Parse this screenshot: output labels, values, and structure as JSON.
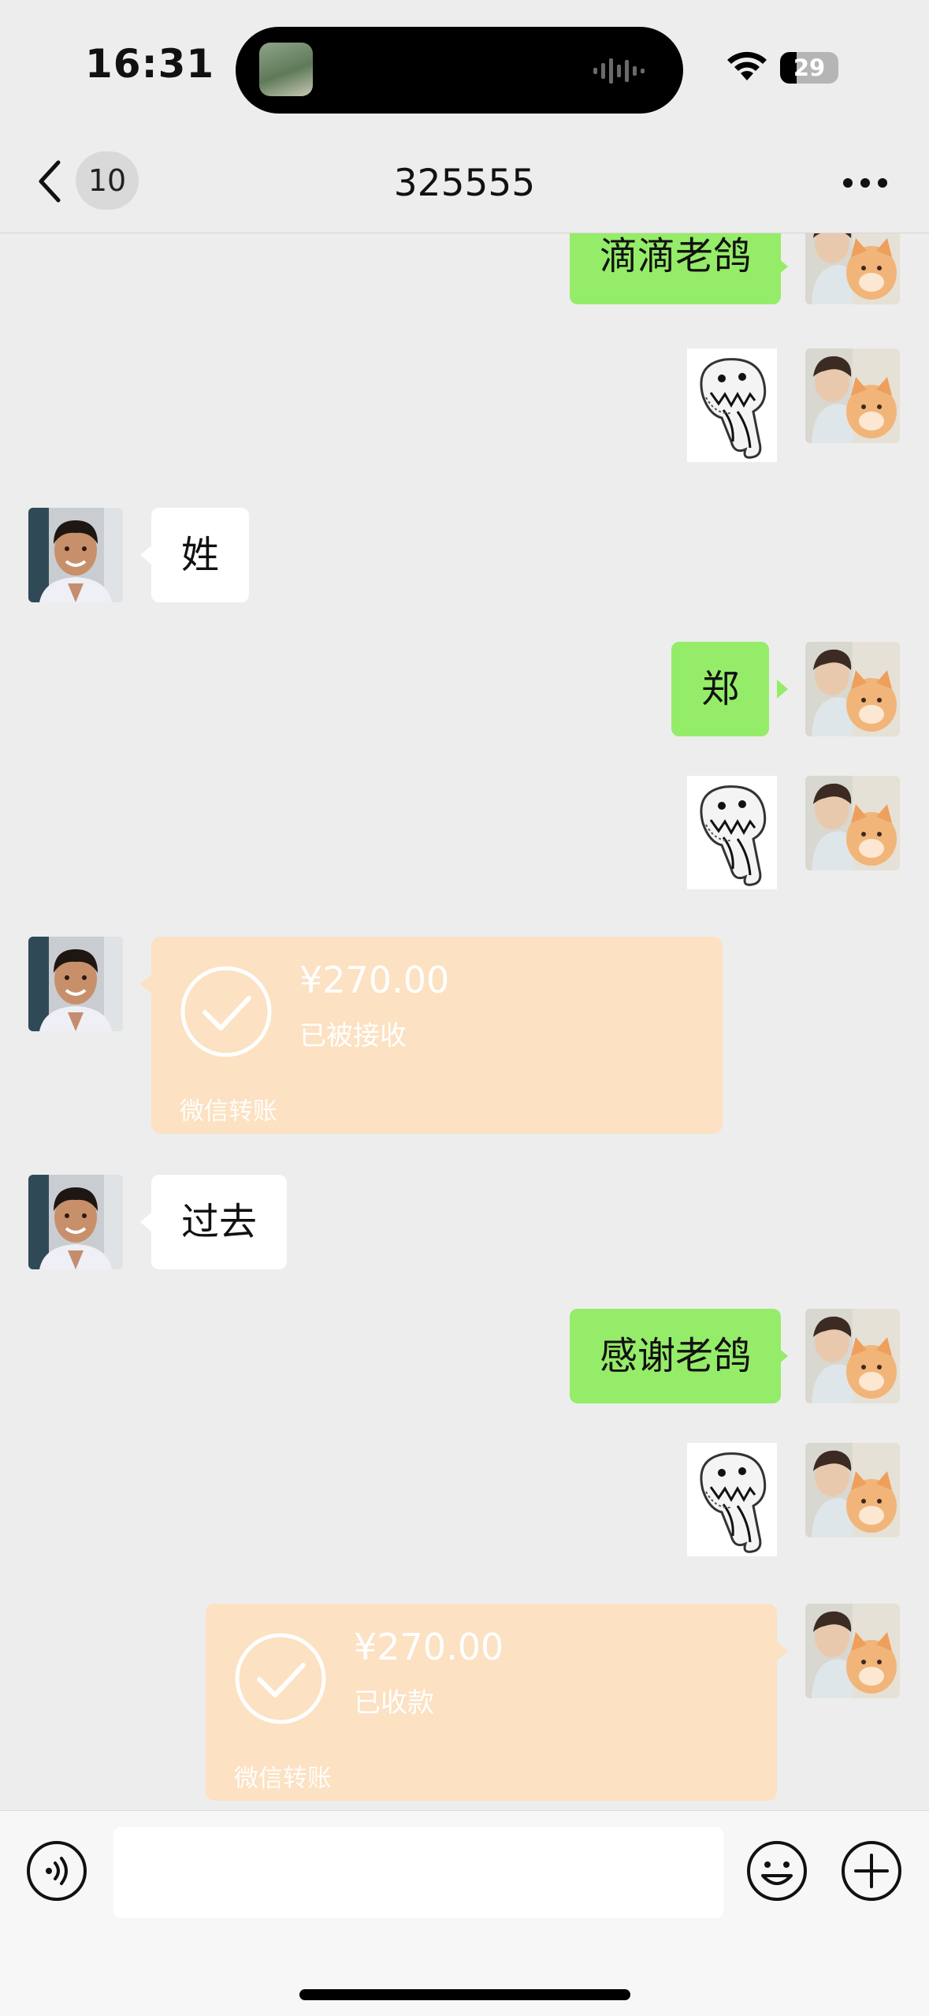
{
  "status_bar": {
    "time": "16:31",
    "battery_level": "29",
    "battery_fraction": 0.29,
    "icons": [
      "wifi-icon",
      "battery-icon",
      "audio-wave-icon"
    ]
  },
  "nav": {
    "unread_count": "10",
    "title": "325555",
    "icons": [
      "back-chevron-icon",
      "more-icon"
    ]
  },
  "messages": [
    {
      "side": "right",
      "type": "text",
      "text": "滴滴老鸽"
    },
    {
      "side": "right",
      "type": "sticker",
      "sticker": "monster-sticker"
    },
    {
      "side": "left",
      "type": "text",
      "text": "姓"
    },
    {
      "side": "right",
      "type": "text",
      "text": "郑"
    },
    {
      "side": "right",
      "type": "sticker",
      "sticker": "monster-sticker"
    },
    {
      "side": "left",
      "type": "transfer",
      "amount": "¥270.00",
      "status": "已被接收",
      "brand": "微信转账"
    },
    {
      "side": "left",
      "type": "text",
      "text": "过去"
    },
    {
      "side": "right",
      "type": "text",
      "text": "感谢老鸽"
    },
    {
      "side": "right",
      "type": "sticker",
      "sticker": "monster-sticker"
    },
    {
      "side": "right",
      "type": "transfer",
      "amount": "¥270.00",
      "status": "已收款",
      "brand": "微信转账"
    }
  ],
  "input_bar": {
    "input_value": "",
    "icons": [
      "voice-icon",
      "emoji-icon",
      "plus-icon"
    ]
  },
  "colors": {
    "background": "#ededed",
    "my_bubble": "#95ec69",
    "their_bubble": "#ffffff",
    "transfer_card": "#fce1c2"
  }
}
